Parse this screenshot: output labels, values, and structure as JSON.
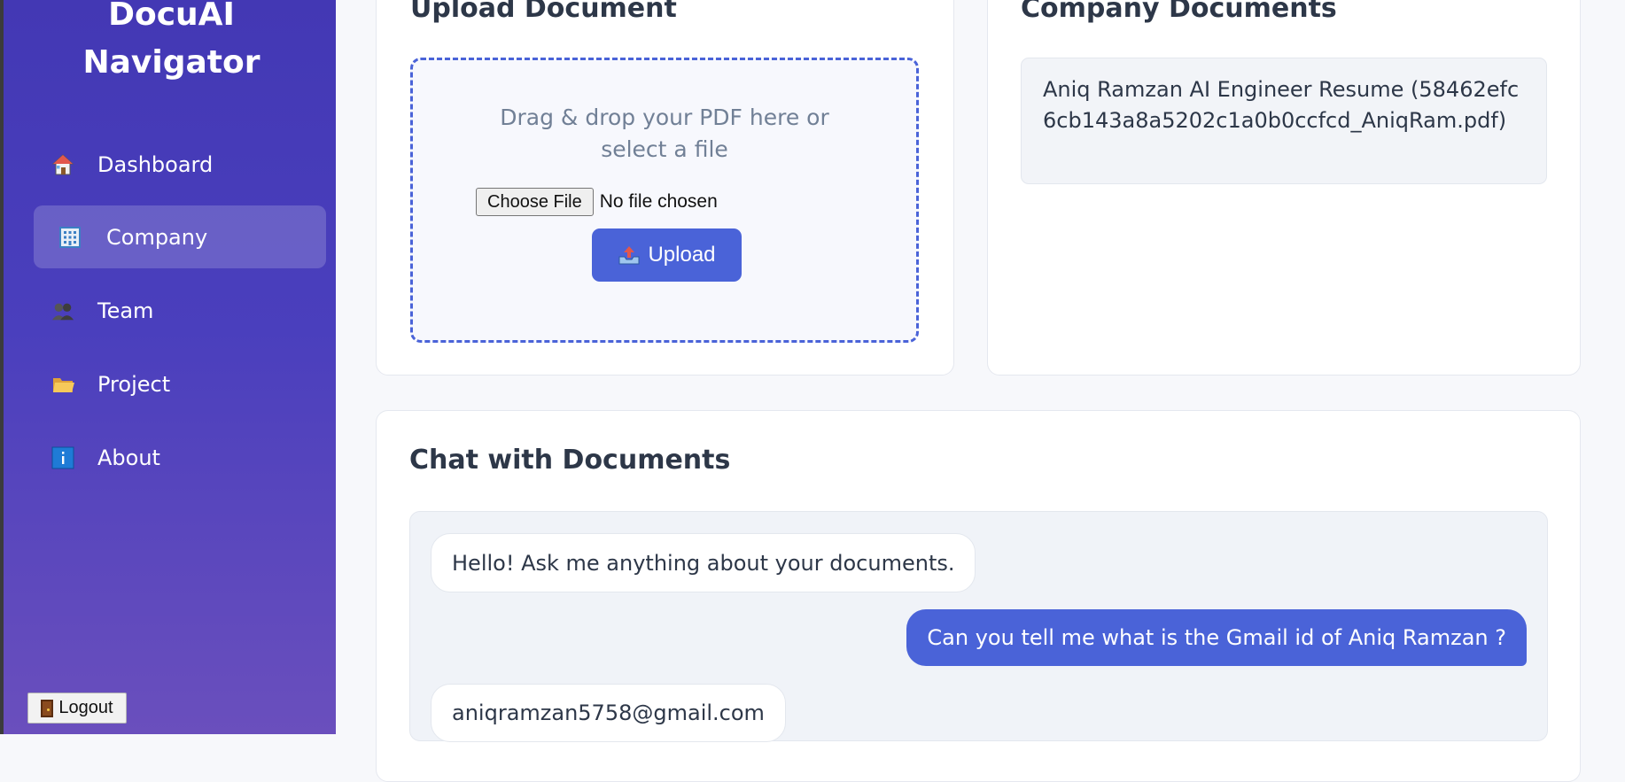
{
  "sidebar": {
    "brand_line1": "DocuAI",
    "brand_line2": "Navigator",
    "items": [
      {
        "label": "Dashboard",
        "icon": "house-icon"
      },
      {
        "label": "Company",
        "icon": "office-building-icon",
        "active": true
      },
      {
        "label": "Team",
        "icon": "people-icon"
      },
      {
        "label": "Project",
        "icon": "folder-icon"
      },
      {
        "label": "About",
        "icon": "info-icon"
      }
    ],
    "logout_label": "Logout"
  },
  "upload": {
    "title": "Upload Document",
    "drop_text": "Drag & drop your PDF here or select a file",
    "choose_file_label": "Choose File",
    "no_file_text": "No file chosen",
    "upload_label": "Upload"
  },
  "company_docs": {
    "title": "Company Documents",
    "documents": [
      "Aniq Ramzan AI Engineer Resume (58462efc6cb143a8a5202c1a0b0ccfcd_AniqRam.pdf)"
    ]
  },
  "chat": {
    "title": "Chat with Documents",
    "messages": [
      {
        "role": "bot",
        "text": "Hello! Ask me anything about your documents."
      },
      {
        "role": "user",
        "text": "Can you tell me what is the Gmail id of Aniq Ramzan ?"
      },
      {
        "role": "bot",
        "text": "aniqramzan5758@gmail.com"
      }
    ]
  },
  "colors": {
    "accent": "#4a63d8",
    "sidebar_top": "#4338b4",
    "sidebar_bottom": "#6a4fbd"
  }
}
